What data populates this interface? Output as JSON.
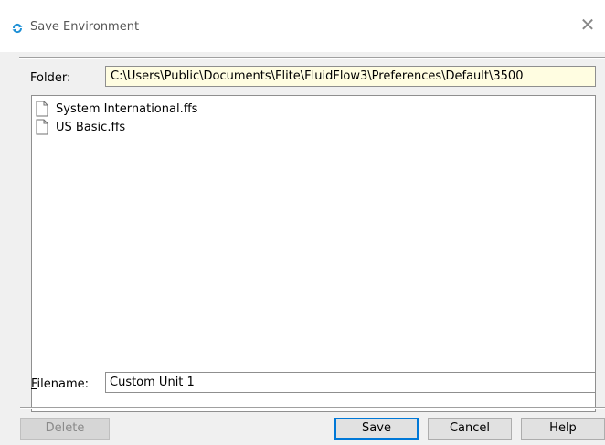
{
  "window": {
    "title": "Save Environment",
    "icon": "refresh-icon",
    "close_glyph": "✕"
  },
  "folder": {
    "label": "Folder:",
    "path": "C:\\Users\\Public\\Documents\\Flite\\FluidFlow3\\Preferences\\Default\\3500"
  },
  "files": [
    {
      "name": "System International.ffs",
      "icon": "file-icon"
    },
    {
      "name": "US Basic.ffs",
      "icon": "file-icon"
    }
  ],
  "filename": {
    "label_access_key": "F",
    "label_rest": "ilename:",
    "value": "Custom Unit 1"
  },
  "buttons": {
    "delete": "Delete",
    "save": "Save",
    "cancel": "Cancel",
    "help": "Help"
  },
  "colors": {
    "folder_field_bg": "#fffde1",
    "default_button_border": "#0078d7",
    "icon_accent": "#1e90d6"
  }
}
